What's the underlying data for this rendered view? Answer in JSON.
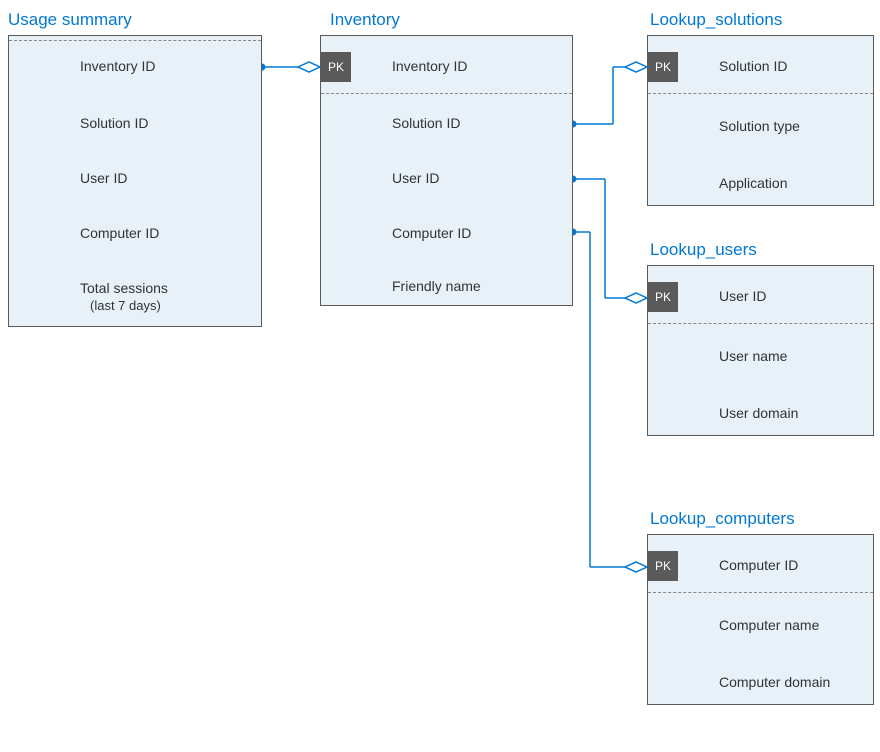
{
  "entities": {
    "usage_summary": {
      "title": "Usage summary",
      "fields": [
        "Inventory ID",
        "Solution ID",
        "User  ID",
        "Computer ID",
        "Total sessions"
      ],
      "sub": "(last 7 days)"
    },
    "inventory": {
      "title": "Inventory",
      "pk": "PK",
      "fields": [
        "Inventory ID",
        "Solution ID",
        "User ID",
        "Computer ID",
        "Friendly name"
      ]
    },
    "lookup_solutions": {
      "title": "Lookup_solutions",
      "pk": "PK",
      "fields": [
        "Solution ID",
        "Solution type",
        "Application"
      ]
    },
    "lookup_users": {
      "title": "Lookup_users",
      "pk": "PK",
      "fields": [
        "User ID",
        "User name",
        "User domain"
      ]
    },
    "lookup_computers": {
      "title": "Lookup_computers",
      "pk": "PK",
      "fields": [
        "Computer ID",
        "Computer name",
        "Computer domain"
      ]
    }
  }
}
